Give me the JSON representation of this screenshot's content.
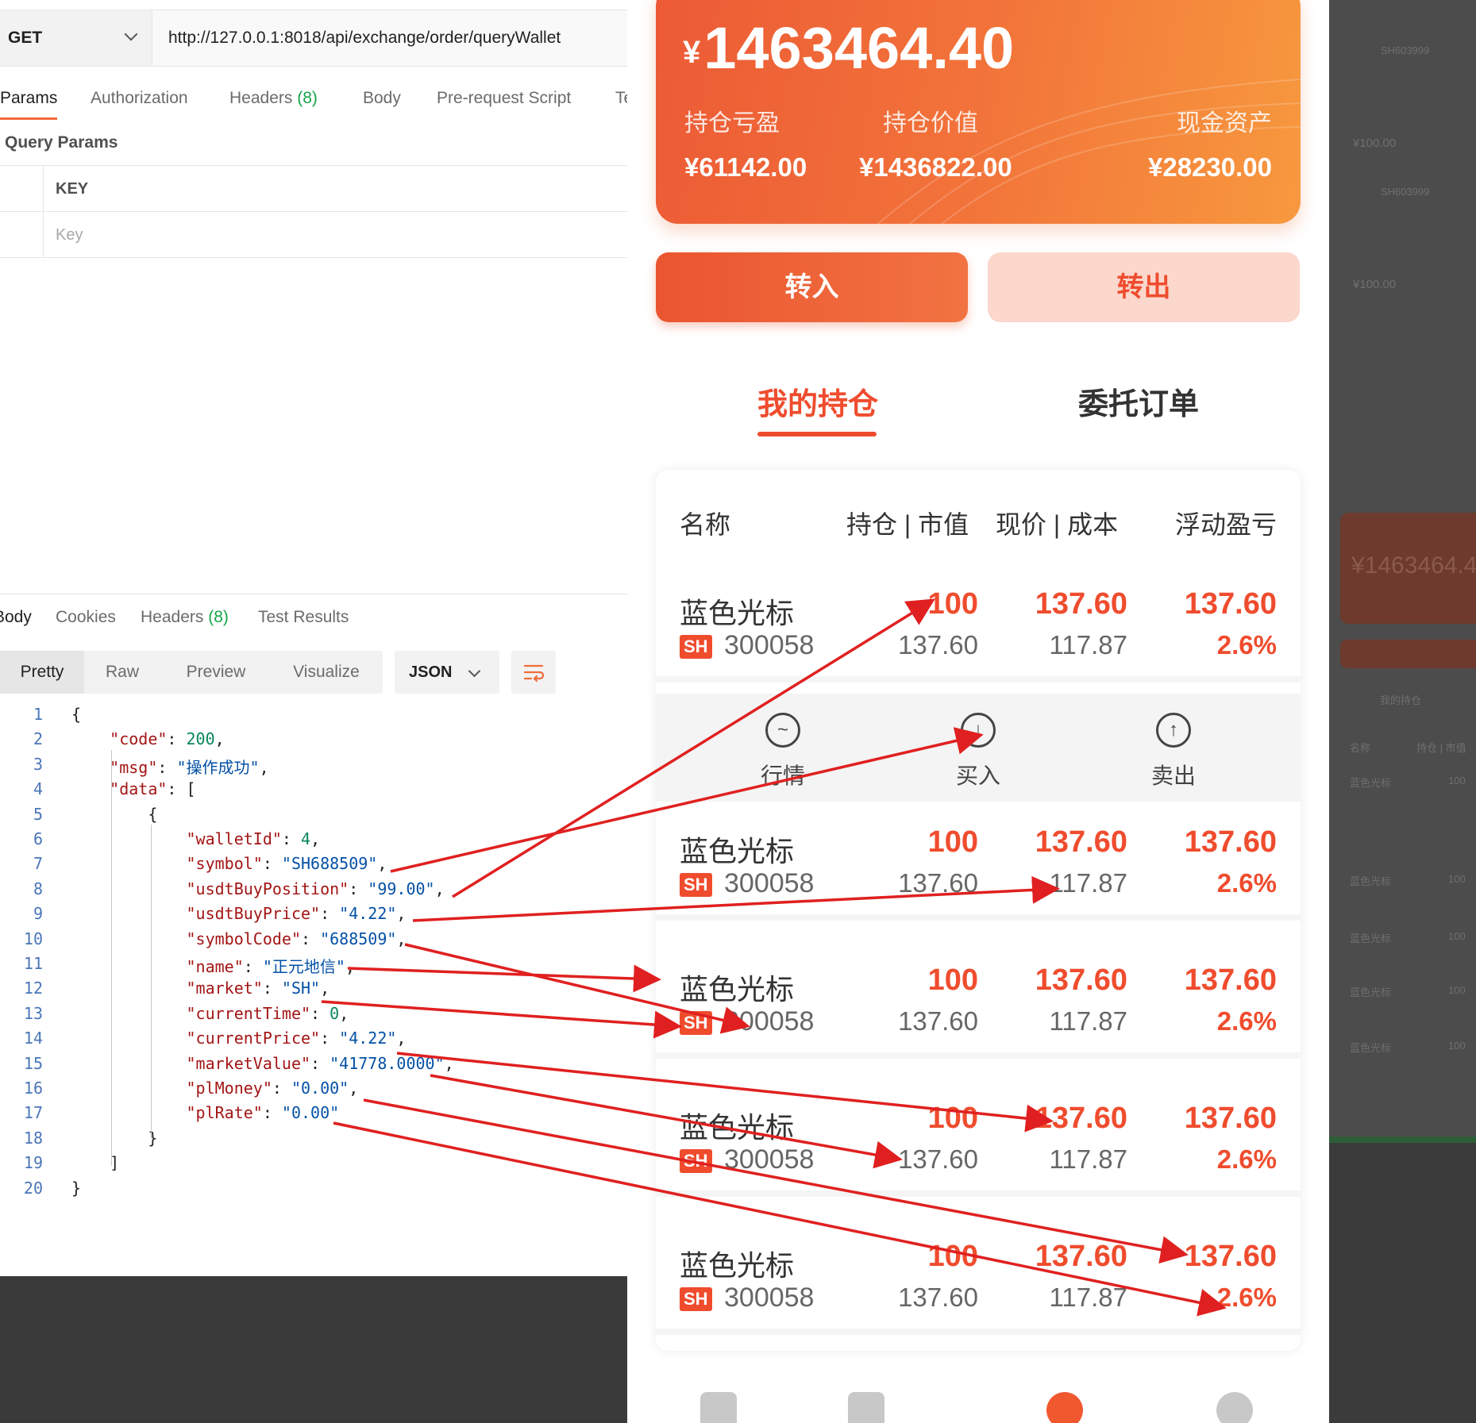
{
  "postman": {
    "method": "GET",
    "url": "http://127.0.0.1:8018/api/exchange/order/queryWallet",
    "request_tabs": [
      {
        "label": "Params",
        "count": ""
      },
      {
        "label": "Authorization",
        "count": ""
      },
      {
        "label": "Headers",
        "count": "(8)"
      },
      {
        "label": "Body",
        "count": ""
      },
      {
        "label": "Pre-request Script",
        "count": ""
      },
      {
        "label": "Te",
        "count": ""
      }
    ],
    "query_params_title": "Query Params",
    "params_header": "KEY",
    "params_placeholder": "Key",
    "response_tabs": [
      {
        "label": "Body",
        "count": ""
      },
      {
        "label": "Cookies",
        "count": ""
      },
      {
        "label": "Headers",
        "count": "(8)"
      },
      {
        "label": "Test Results",
        "count": ""
      }
    ],
    "view_tabs": [
      "Pretty",
      "Raw",
      "Preview",
      "Visualize"
    ],
    "format": "JSON",
    "json_lines": [
      "{",
      "    \"code\": 200,",
      "    \"msg\": \"操作成功\",",
      "    \"data\": [",
      "        {",
      "            \"walletId\": 4,",
      "            \"symbol\": \"SH688509\",",
      "            \"usdtBuyPosition\": \"99.00\",",
      "            \"usdtBuyPrice\": \"4.22\",",
      "            \"symbolCode\": \"688509\",",
      "            \"name\": \"正元地信\",",
      "            \"market\": \"SH\",",
      "            \"currentTime\": 0,",
      "            \"currentPrice\": \"4.22\",",
      "            \"marketValue\": \"41778.0000\",",
      "            \"plMoney\": \"0.00\",",
      "            \"plRate\": \"0.00\"",
      "        }",
      "    ]",
      "}"
    ]
  },
  "app": {
    "total_assets": "1463464.40",
    "currency_symbol": "¥",
    "summary": [
      {
        "label": "持仓亏盈",
        "value": "¥61142.00"
      },
      {
        "label": "持仓价值",
        "value": "¥1436822.00"
      },
      {
        "label": "现金资产",
        "value": "¥28230.00"
      }
    ],
    "transfer_in": "转入",
    "transfer_out": "转出",
    "tabs": [
      "我的持仓",
      "委托订单"
    ],
    "table_headers": {
      "name": "名称",
      "position_value": "持仓 | 市值",
      "price_cost": "现价 | 成本",
      "pnl": "浮动盈亏"
    },
    "row_actions": [
      "行情",
      "买入",
      "卖出"
    ],
    "holdings": [
      {
        "name": "蓝色光标",
        "market": "SH",
        "code": "300058",
        "position": "100",
        "market_value": "137.60",
        "price": "137.60",
        "cost": "117.87",
        "pnl": "137.60",
        "pnl_rate": "2.6%"
      },
      {
        "name": "蓝色光标",
        "market": "SH",
        "code": "300058",
        "position": "100",
        "market_value": "137.60",
        "price": "137.60",
        "cost": "117.87",
        "pnl": "137.60",
        "pnl_rate": "2.6%"
      },
      {
        "name": "蓝色光标",
        "market": "SH",
        "code": "300058",
        "position": "100",
        "market_value": "137.60",
        "price": "137.60",
        "cost": "117.87",
        "pnl": "137.60",
        "pnl_rate": "2.6%"
      },
      {
        "name": "蓝色光标",
        "market": "SH",
        "code": "300058",
        "position": "100",
        "market_value": "137.60",
        "price": "137.60",
        "cost": "117.87",
        "pnl": "137.60",
        "pnl_rate": "2.6%"
      },
      {
        "name": "蓝色光标",
        "market": "SH",
        "code": "300058",
        "position": "100",
        "market_value": "137.60",
        "price": "137.60",
        "cost": "117.87",
        "pnl": "137.60",
        "pnl_rate": "2.6%"
      }
    ]
  },
  "dim_panel": {
    "total_assets": "¥1463464.4",
    "tab": "我的持仓",
    "symbol": "SH603999",
    "amount": "¥100.00",
    "header_name": "名称",
    "header_cols": "持仓 | 市值",
    "row_name": "蓝色光标",
    "row_value": "100"
  },
  "colors": {
    "accent": "#ef4c2e",
    "arrow": "#e02020",
    "postman_orange": "#f26b3a"
  }
}
